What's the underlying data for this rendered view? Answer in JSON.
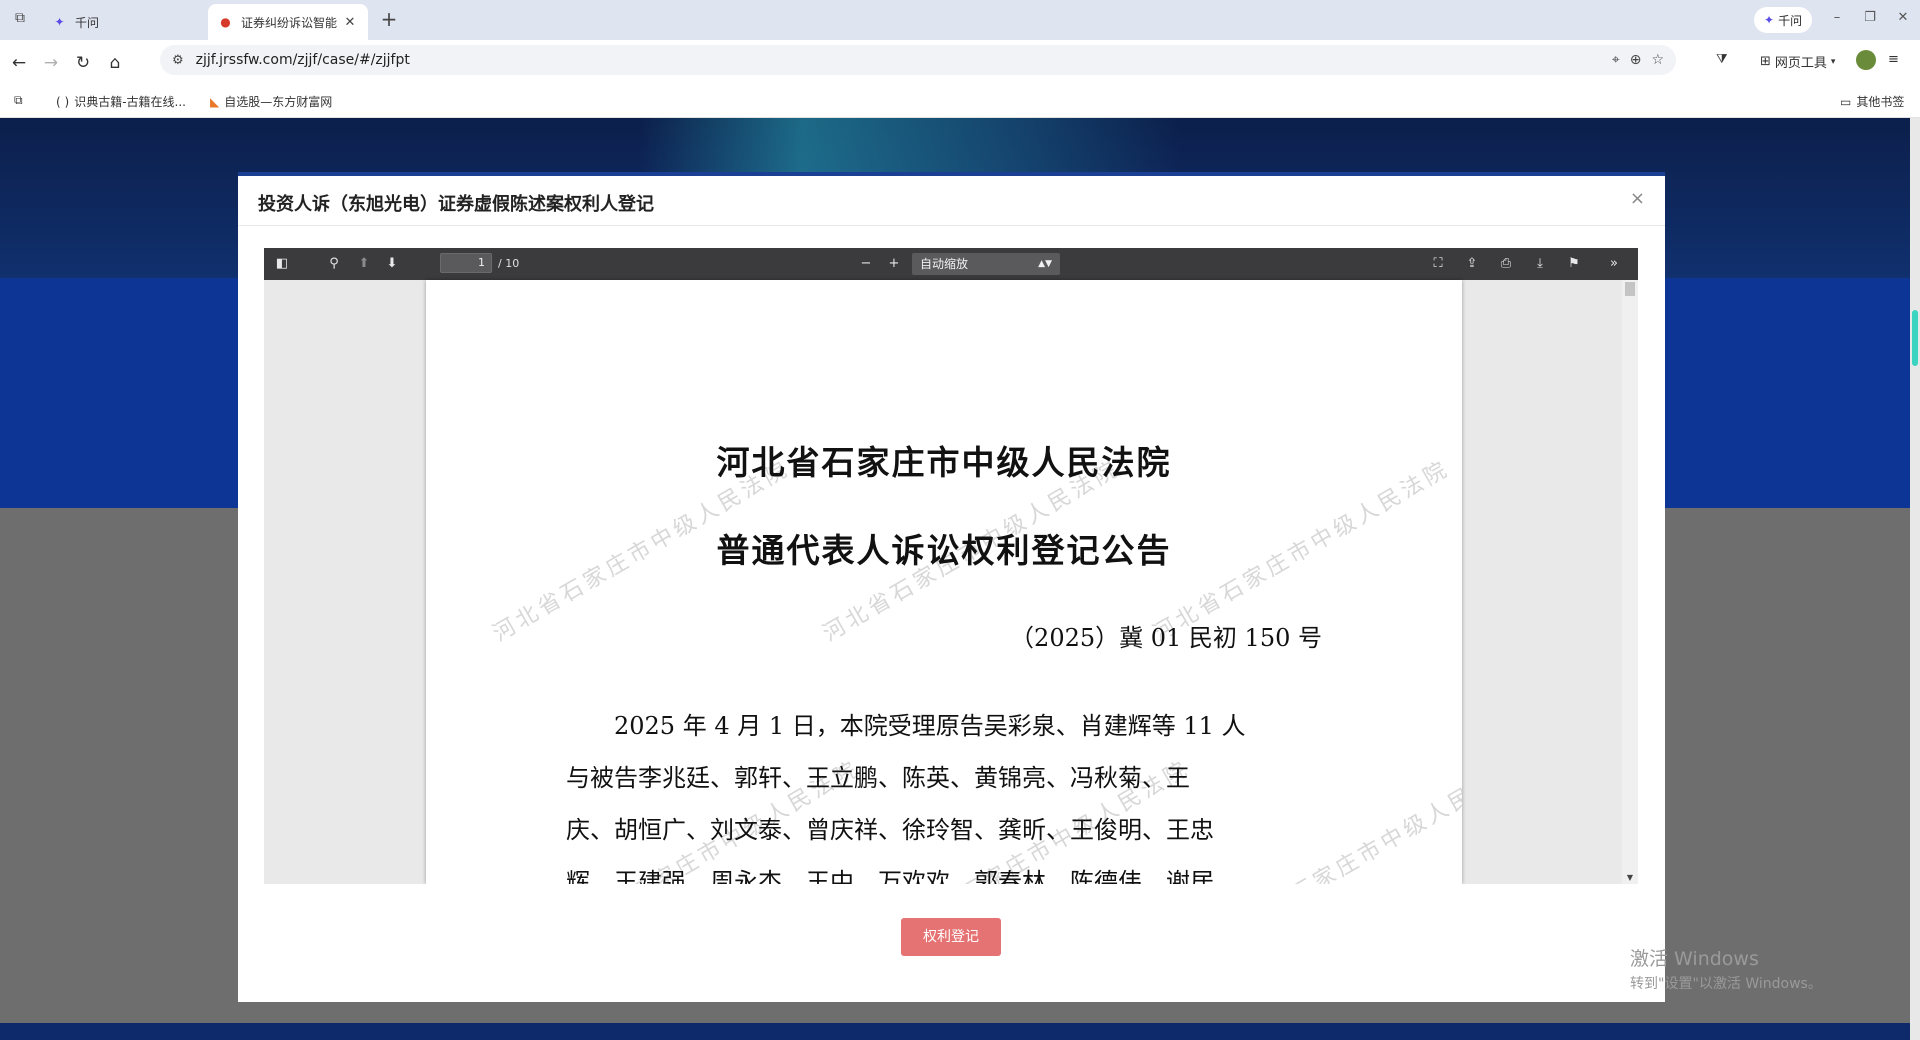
{
  "browser": {
    "tabs": [
      {
        "title": "千问",
        "icon": "qianwen-icon"
      },
      {
        "title": "证券纠纷诉讼智能",
        "icon": "court-emblem-icon"
      }
    ],
    "new_tab_symbol": "+",
    "qianwen_button": "千问",
    "url": "zjjf.jrssfw.com/zjjf/case/#/zjjfpt",
    "web_tools_label": "网页工具",
    "bookmarks": [
      {
        "label": "识典古籍-古籍在线..."
      },
      {
        "label": "自选股—东方财富网"
      }
    ],
    "other_bookmarks_label": "其他书签"
  },
  "modal": {
    "title": "投资人诉（东旭光电）证券虚假陈述案权利人登记",
    "close_symbol": "×",
    "register_button": "权利登记"
  },
  "pdf_viewer": {
    "current_page": "1",
    "page_total": "/ 10",
    "zoom_option": "自动缩放"
  },
  "document": {
    "title_line1": "河北省石家庄市中级人民法院",
    "title_line2": "普通代表人诉讼权利登记公告",
    "case_number": "（2025）冀 01 民初 150 号",
    "body_lines": [
      "　　2025 年 4 月 1 日，本院受理原告吴彩泉、肖建辉等 11 人",
      "与被告李兆廷、郭轩、王立鹏、陈英、黄锦亮、冯秋菊、王",
      "庆、胡恒广、刘文泰、曾庆祥、徐玲智、龚昕、王俊明、王忠",
      "辉、王建强、周永杰、王中、万欢欢、郭春林、陈德伟、谢居"
    ],
    "watermark_text": "河北省石家庄市中级人民法院"
  },
  "os_watermark": {
    "line1": "激活 Windows",
    "line2": "转到\"设置\"以激活 Windows。"
  },
  "colors": {
    "register_button": "#e57373",
    "modal_top_border": "#1b3f93",
    "pdf_toolbar": "#3b3b3d"
  }
}
